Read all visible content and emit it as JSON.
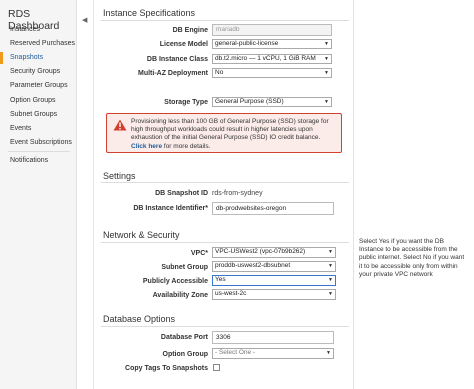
{
  "sidebar": {
    "title": "RDS Dashboard",
    "items": [
      {
        "label": "Instances"
      },
      {
        "label": "Reserved Purchases"
      },
      {
        "label": "Snapshots"
      },
      {
        "label": "Security Groups"
      },
      {
        "label": "Parameter Groups"
      },
      {
        "label": "Option Groups"
      },
      {
        "label": "Subnet Groups"
      },
      {
        "label": "Events"
      },
      {
        "label": "Event Subscriptions"
      },
      {
        "label": "Notifications"
      }
    ],
    "active_item": "Snapshots",
    "collapse_glyph": "◀"
  },
  "instance_specs": {
    "title": "Instance Specifications",
    "db_engine": {
      "label": "DB Engine",
      "value": "mariadb"
    },
    "license_model": {
      "label": "License Model",
      "value": "general-public-license"
    },
    "instance_class": {
      "label": "DB Instance Class",
      "value": "db.t2.micro — 1 vCPU, 1 GiB RAM"
    },
    "multi_az": {
      "label": "Multi-AZ Deployment",
      "value": "No"
    },
    "storage_type": {
      "label": "Storage Type",
      "value": "General Purpose (SSD)"
    },
    "warning": {
      "text": "Provisioning less than 100 GB of General Purpose (SSD) storage for high throughput workloads could result in higher latencies upon exhaustion of the initial General Purpose (SSD) IO credit balance.",
      "link": "Click here",
      "suffix": " for more details."
    }
  },
  "settings": {
    "title": "Settings",
    "snapshot_id": {
      "label": "DB Snapshot ID",
      "value": "rds-from-sydney"
    },
    "instance_identifier": {
      "label": "DB Instance Identifier*",
      "value": "db-prodwebsites-oregon"
    }
  },
  "network": {
    "title": "Network & Security",
    "vpc": {
      "label": "VPC*",
      "value": "VPC-USWest2 (vpc-07b9b262)"
    },
    "subnet_group": {
      "label": "Subnet Group",
      "value": "proddb-uswest2-dbsubnet"
    },
    "publicly_accessible": {
      "label": "Publicly Accessible",
      "value": "Yes"
    },
    "availability_zone": {
      "label": "Availability Zone",
      "value": "us-west-2c"
    }
  },
  "db_options": {
    "title": "Database Options",
    "port": {
      "label": "Database Port",
      "value": "3306"
    },
    "option_group": {
      "label": "Option Group",
      "value": "- Select One -"
    },
    "copy_tags": {
      "label": "Copy Tags To Snapshots",
      "checked": false
    }
  },
  "help_text": "Select Yes if you want the DB Instance to be accessible from the public internet. Select No if you want it to be accessible only from within your private VPC network",
  "colors": {
    "accent": "#1f5c99",
    "active_marker": "#f09a1a",
    "warning_border": "#d0412f",
    "warning_bg": "#fbecea"
  }
}
